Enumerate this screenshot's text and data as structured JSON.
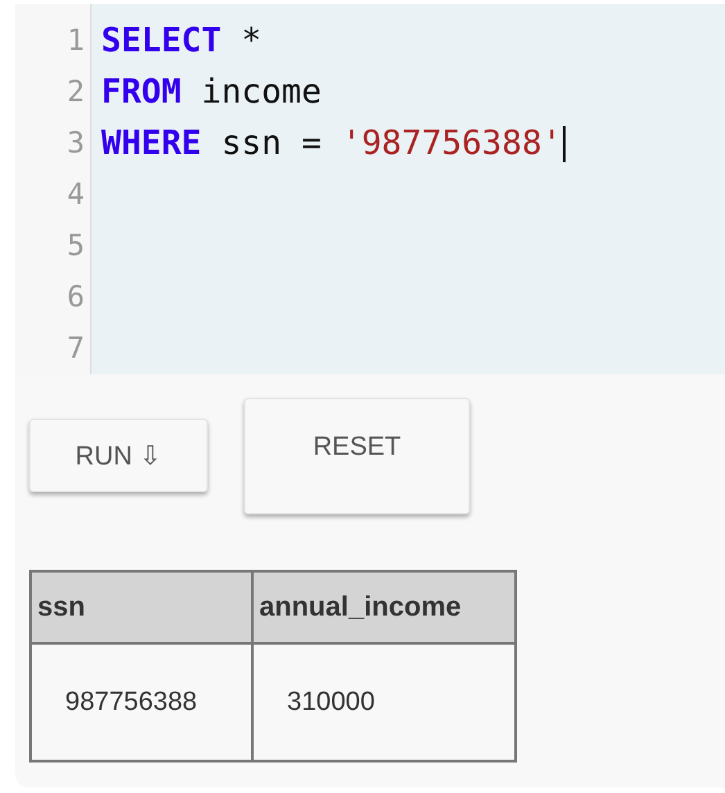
{
  "editor": {
    "lines": [
      {
        "number": "1",
        "tokens": [
          {
            "kind": "keyword",
            "text": "SELECT"
          },
          {
            "kind": "plain",
            "text": " *"
          }
        ]
      },
      {
        "number": "2",
        "tokens": [
          {
            "kind": "keyword",
            "text": "FROM"
          },
          {
            "kind": "plain",
            "text": " income"
          }
        ]
      },
      {
        "number": "3",
        "cursor": true,
        "tokens": [
          {
            "kind": "keyword",
            "text": "WHERE"
          },
          {
            "kind": "plain",
            "text": " ssn = "
          },
          {
            "kind": "string",
            "text": "'987756388'"
          }
        ]
      },
      {
        "number": "4"
      },
      {
        "number": "5"
      },
      {
        "number": "6"
      },
      {
        "number": "7"
      }
    ]
  },
  "buttons": [
    {
      "label": "RUN ⇩",
      "kind": "small"
    },
    {
      "label": "RESET",
      "kind": "large"
    }
  ],
  "table": {
    "columns": [
      "ssn",
      "annual_income"
    ],
    "rows": [
      [
        "987756388",
        "310000"
      ]
    ]
  }
}
